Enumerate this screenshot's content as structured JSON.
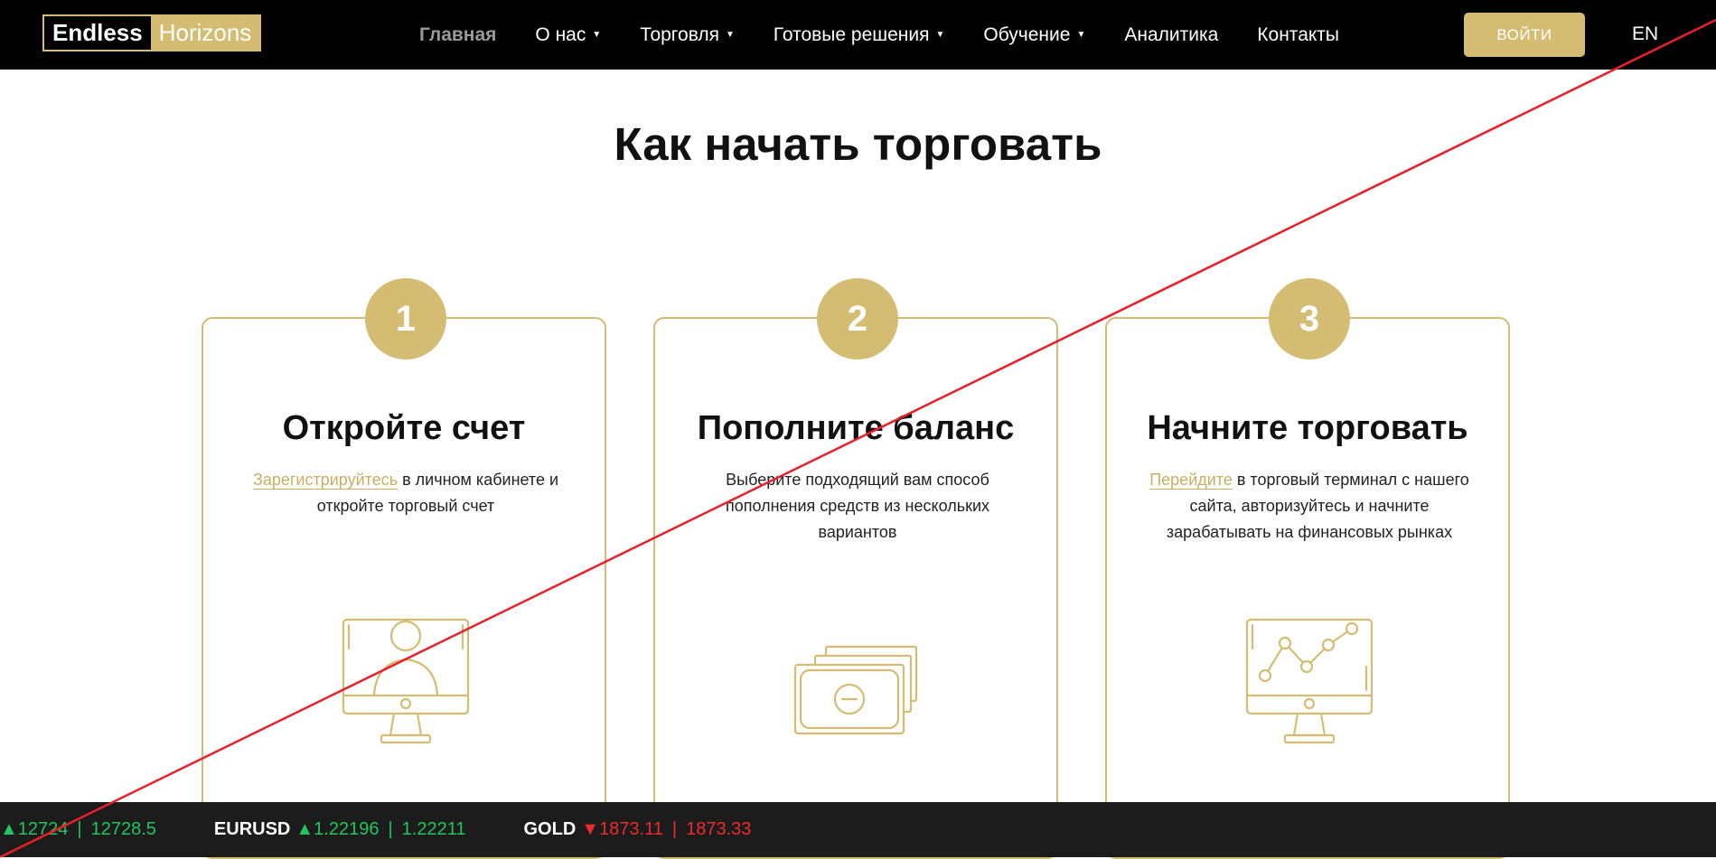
{
  "header": {
    "logo_left": "Endless",
    "logo_right": "Horizons",
    "nav": [
      {
        "label": "Главная",
        "active": true,
        "dropdown": false
      },
      {
        "label": "О нас",
        "active": false,
        "dropdown": true
      },
      {
        "label": "Торговля",
        "active": false,
        "dropdown": true
      },
      {
        "label": "Готовые решения",
        "active": false,
        "dropdown": true
      },
      {
        "label": "Обучение",
        "active": false,
        "dropdown": true
      },
      {
        "label": "Аналитика",
        "active": false,
        "dropdown": false
      },
      {
        "label": "Контакты",
        "active": false,
        "dropdown": false
      }
    ],
    "login_label": "ВОЙТИ",
    "lang_label": "EN"
  },
  "main": {
    "title": "Как начать торговать",
    "steps": [
      {
        "number": "1",
        "title": "Откройте счет",
        "link_text": "Зарегистрируйтесь",
        "text_after_link": " в личном кабинете и откройте торговый счет",
        "icon": "monitor-user-icon"
      },
      {
        "number": "2",
        "title": "Пополните баланс",
        "text": "Выберите подходящий вам способ пополнения средств из нескольких вариантов",
        "icon": "banknotes-icon"
      },
      {
        "number": "3",
        "title": "Начните торговать",
        "link_text": "Перейдите",
        "text_after_link": " в торговый терминал с нашего сайта, авторизуйтесь и начните зарабатывать на финансовых рынках",
        "icon": "monitor-chart-icon"
      }
    ]
  },
  "ticker": [
    {
      "name": "",
      "direction": "up",
      "bid": "12724",
      "ask": "12728.5"
    },
    {
      "name": "EURUSD",
      "direction": "up",
      "bid": "1.22196",
      "ask": "1.22211"
    },
    {
      "name": "GOLD",
      "direction": "down",
      "bid": "1873.11",
      "ask": "1873.33"
    }
  ],
  "colors": {
    "accent": "#d4bc72",
    "header_bg": "#000000",
    "ticker_bg": "#1c1c1c",
    "up": "#22c55e",
    "down": "#ef2b2b",
    "overlay_line": "#e8202a"
  }
}
